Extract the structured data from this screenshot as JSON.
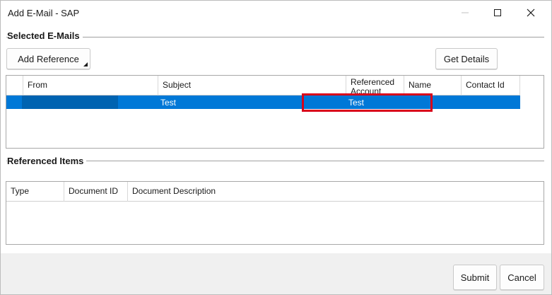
{
  "window": {
    "title": "Add E-Mail - SAP",
    "controls": {
      "minimize": "minimize-icon",
      "maximize": "maximize-icon",
      "close": "close-icon"
    }
  },
  "selected_emails": {
    "section_title": "Selected E-Mails",
    "add_reference_label": "Add Reference",
    "get_details_label": "Get Details",
    "columns": [
      "From",
      "Subject",
      "Referenced Account",
      "Name",
      "Contact Id"
    ],
    "rows": [
      {
        "from": "",
        "subject": "Test",
        "referenced_account": "Test",
        "name": "",
        "contact_id": ""
      }
    ]
  },
  "referenced_items": {
    "section_title": "Referenced Items",
    "columns": [
      "Type",
      "Document ID",
      "Document Description"
    ]
  },
  "footer": {
    "submit_label": "Submit",
    "cancel_label": "Cancel"
  },
  "colors": {
    "selection": "#0078d7",
    "highlight": "#d9001a"
  }
}
